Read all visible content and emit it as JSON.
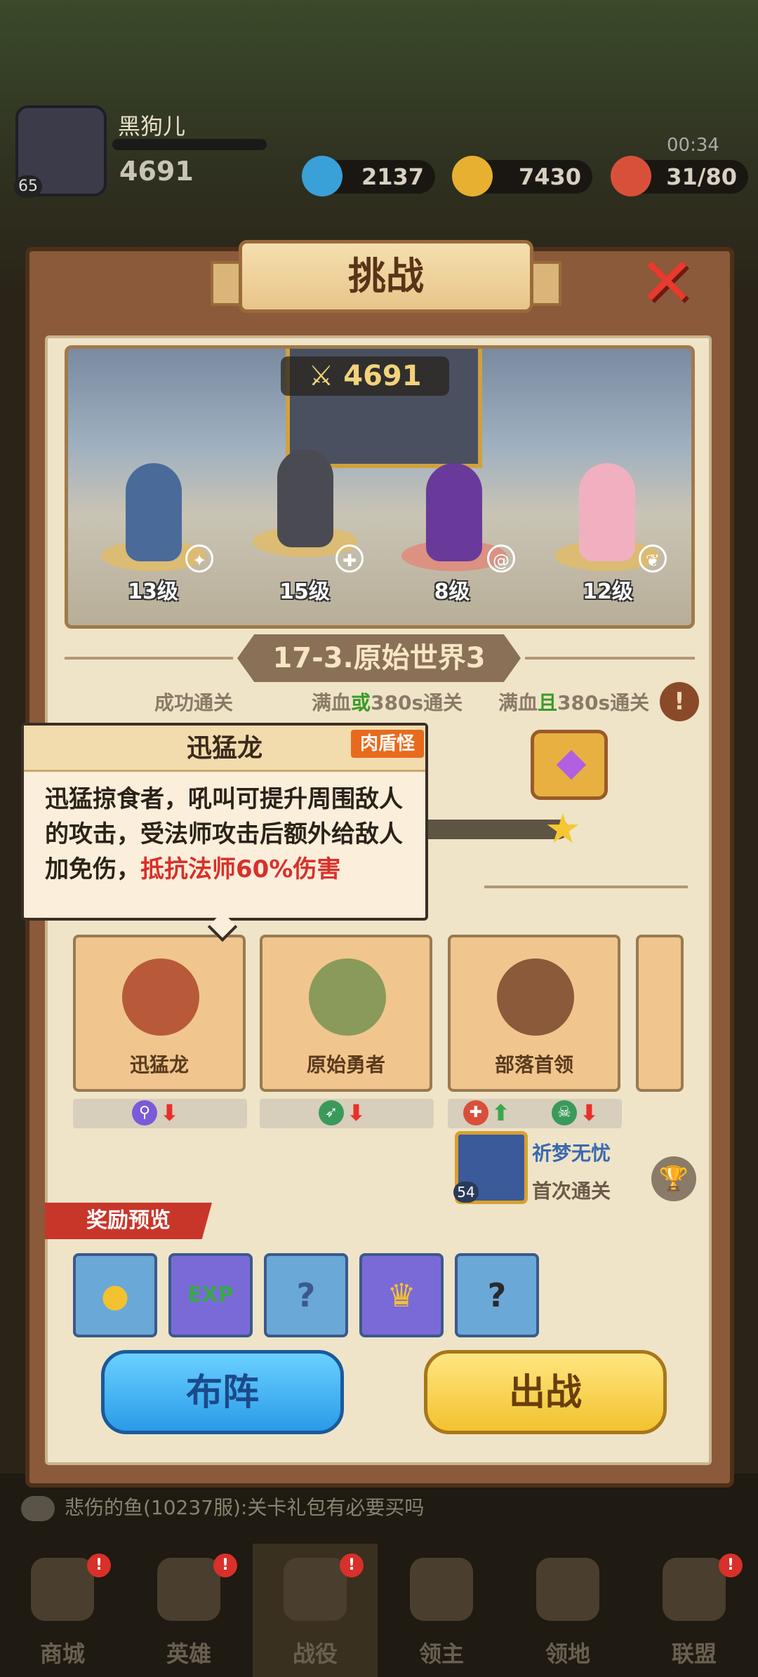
{
  "hud": {
    "player_name": "黑狗儿",
    "player_level": "65",
    "power": "4691",
    "gems": "2137",
    "gold": "7430",
    "stamina": "31/80",
    "timer": "00:34"
  },
  "dialog": {
    "title": "挑战",
    "close_icon": "close-icon"
  },
  "scene": {
    "team_power": "4691",
    "heroes": [
      {
        "level": "13级",
        "class_icon": "paw-icon",
        "badge_color": "#3a6ad8"
      },
      {
        "level": "15级",
        "class_icon": "shield-icon",
        "badge_color": "#d8503a"
      },
      {
        "level": "8级",
        "class_icon": "swirl-icon",
        "badge_color": "#3a7ad8"
      },
      {
        "level": "12级",
        "class_icon": "wings-icon",
        "badge_color": "#c89a3a"
      }
    ]
  },
  "stage": {
    "title": "17-3.原始世界3",
    "conditions": {
      "c1": "成功通关",
      "c2_a": "满血",
      "c2_b": "或",
      "c2_c": "380s通关",
      "c3_a": "满血",
      "c3_b": "且",
      "c3_c": "380s通关"
    },
    "info_icon": "!"
  },
  "tooltip": {
    "title": "迅猛龙",
    "tag": "肉盾怪",
    "text_plain": "迅猛掠食者，吼叫可提升周围敌人的攻击，受法师攻击后额外给敌人加免伤，",
    "text_red": "抵抗法师60%伤害"
  },
  "enemies": [
    {
      "name": "迅猛龙",
      "tags": [
        {
          "icon": "staff-icon",
          "color": "#7a5ad8",
          "dir": "down"
        }
      ]
    },
    {
      "name": "原始勇者",
      "tags": [
        {
          "icon": "bow-icon",
          "color": "#3a9a5a",
          "dir": "down"
        }
      ]
    },
    {
      "name": "部落首领",
      "tags": [
        {
          "icon": "shield-icon",
          "color": "#d8503a",
          "dir": "up"
        },
        {
          "icon": "skull-icon",
          "color": "#3a9a5a",
          "dir": "down"
        }
      ]
    }
  ],
  "first_clear": {
    "player": "祈梦无忧",
    "label": "首次通关",
    "level": "54"
  },
  "reward": {
    "header": "奖励预览",
    "items": [
      {
        "name": "gold-coin-icon",
        "glyph": "●",
        "bg": "#6aa8d8",
        "color": "#f2c230"
      },
      {
        "name": "exp-orb-icon",
        "glyph": "EXP",
        "bg": "#7a6ad8",
        "color": "#3aa84a"
      },
      {
        "name": "mystery-scroll-icon",
        "glyph": "?",
        "bg": "#6aa8d8",
        "color": "#3a5a8a"
      },
      {
        "name": "ticket-icon",
        "glyph": "♛",
        "bg": "#7a6ad8",
        "color": "#f2c230"
      },
      {
        "name": "mystery-armor-icon",
        "glyph": "?",
        "bg": "#6aa8d8",
        "color": "#2a2a2a"
      }
    ]
  },
  "buttons": {
    "formation": "布阵",
    "battle": "出战"
  },
  "chat": {
    "message": "悲伤的鱼(10237服):关卡礼包有必要买吗"
  },
  "nav": [
    {
      "label": "商城",
      "badge": "!"
    },
    {
      "label": "英雄",
      "badge": "!"
    },
    {
      "label": "战役",
      "badge": "!"
    },
    {
      "label": "领主",
      "badge": ""
    },
    {
      "label": "领地",
      "badge": ""
    },
    {
      "label": "联盟",
      "badge": "!"
    }
  ]
}
